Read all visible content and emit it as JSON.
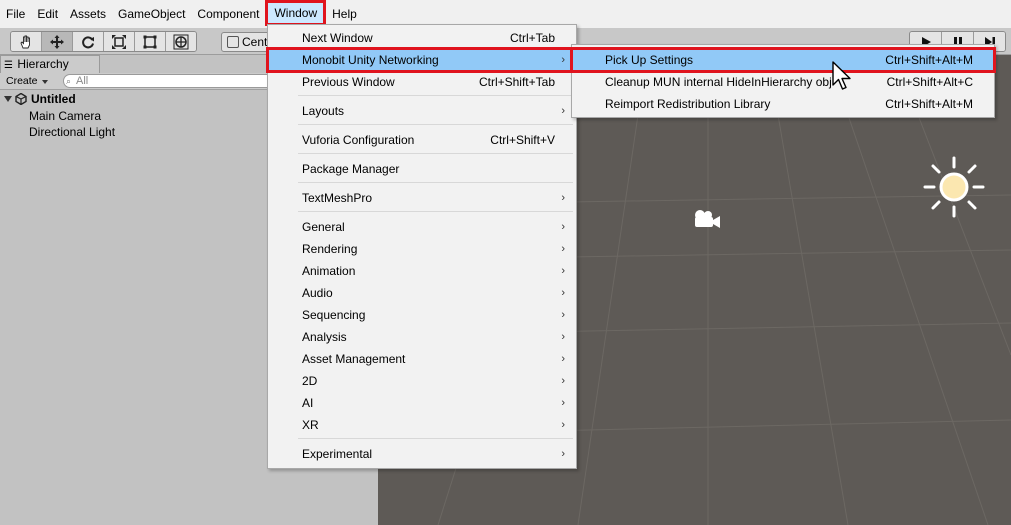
{
  "menubar": {
    "items": [
      "File",
      "Edit",
      "Assets",
      "GameObject",
      "Component",
      "Window",
      "Help"
    ],
    "active": "Window"
  },
  "toolbar": {
    "tools": [
      "hand-tool-icon",
      "move-tool-icon",
      "rotate-tool-icon",
      "scale-tool-icon",
      "rect-tool-icon",
      "transform-tool-icon"
    ],
    "pivot_label": "Cent",
    "play_controls": [
      "play-icon",
      "pause-icon",
      "step-icon"
    ]
  },
  "hierarchy": {
    "tab_label": "Hierarchy",
    "create_label": "Create",
    "search_placeholder": "All",
    "scene_name": "Untitled",
    "objects": [
      "Main Camera",
      "Directional Light"
    ]
  },
  "window_menu": {
    "items": [
      {
        "label": "Next Window",
        "shortcut": "Ctrl+Tab",
        "submenu": false
      },
      {
        "label": "Monobit Unity Networking",
        "shortcut": "",
        "submenu": true,
        "highlighted": true
      },
      {
        "label": "Previous Window",
        "shortcut": "Ctrl+Shift+Tab",
        "submenu": false
      },
      {
        "label": "Layouts",
        "shortcut": "",
        "submenu": true
      },
      {
        "label": "Vuforia Configuration",
        "shortcut": "Ctrl+Shift+V",
        "submenu": false
      },
      {
        "label": "Package Manager",
        "shortcut": "",
        "submenu": false
      },
      {
        "label": "TextMeshPro",
        "shortcut": "",
        "submenu": true
      },
      {
        "label": "General",
        "shortcut": "",
        "submenu": true
      },
      {
        "label": "Rendering",
        "shortcut": "",
        "submenu": true
      },
      {
        "label": "Animation",
        "shortcut": "",
        "submenu": true
      },
      {
        "label": "Audio",
        "shortcut": "",
        "submenu": true
      },
      {
        "label": "Sequencing",
        "shortcut": "",
        "submenu": true
      },
      {
        "label": "Analysis",
        "shortcut": "",
        "submenu": true
      },
      {
        "label": "Asset Management",
        "shortcut": "",
        "submenu": true
      },
      {
        "label": "2D",
        "shortcut": "",
        "submenu": true
      },
      {
        "label": "AI",
        "shortcut": "",
        "submenu": true
      },
      {
        "label": "XR",
        "shortcut": "",
        "submenu": true
      },
      {
        "label": "Experimental",
        "shortcut": "",
        "submenu": true
      }
    ]
  },
  "sub_menu": {
    "items": [
      {
        "label": "Pick Up Settings",
        "shortcut": "Ctrl+Shift+Alt+M",
        "highlighted": true
      },
      {
        "label": "Cleanup MUN internal HideInHierarchy obj",
        "shortcut": "Ctrl+Shift+Alt+C"
      },
      {
        "label": "Reimport Redistribution Library",
        "shortcut": "Ctrl+Shift+Alt+M"
      }
    ]
  },
  "colors": {
    "menu_highlight": "#91c9f7",
    "callout_red": "#e0141e",
    "scene_bg": "#5e5a56",
    "panel_bg": "#c2c2c2"
  }
}
